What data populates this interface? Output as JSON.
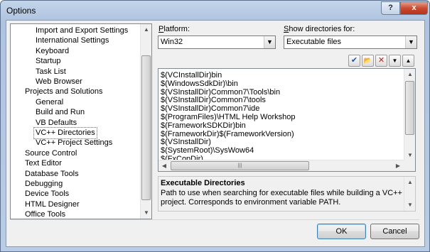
{
  "window": {
    "title": "Options",
    "help_label": "?",
    "close_label": "x"
  },
  "tree": {
    "items": [
      {
        "label": "Import and Export Settings",
        "level": 1
      },
      {
        "label": "International Settings",
        "level": 1
      },
      {
        "label": "Keyboard",
        "level": 1
      },
      {
        "label": "Startup",
        "level": 1
      },
      {
        "label": "Task List",
        "level": 1
      },
      {
        "label": "Web Browser",
        "level": 1
      },
      {
        "label": "Projects and Solutions",
        "level": 0
      },
      {
        "label": "General",
        "level": 1
      },
      {
        "label": "Build and Run",
        "level": 1
      },
      {
        "label": "VB Defaults",
        "level": 1
      },
      {
        "label": "VC++ Directories",
        "level": 1,
        "selected": true
      },
      {
        "label": "VC++ Project Settings",
        "level": 1
      },
      {
        "label": "Source Control",
        "level": 0
      },
      {
        "label": "Text Editor",
        "level": 0
      },
      {
        "label": "Database Tools",
        "level": 0
      },
      {
        "label": "Debugging",
        "level": 0
      },
      {
        "label": "Device Tools",
        "level": 0
      },
      {
        "label": "HTML Designer",
        "level": 0
      },
      {
        "label": "Office Tools",
        "level": 0
      }
    ]
  },
  "platform": {
    "label_prefix": "",
    "label_underlined": "P",
    "label_rest": "latform:",
    "value": "Win32"
  },
  "show_dirs": {
    "label_prefix": "",
    "label_underlined": "S",
    "label_rest": "how directories for:",
    "value": "Executable files"
  },
  "toolbar": {
    "check_glyph": "✔",
    "folder_glyph": "📂",
    "delete_glyph": "✕",
    "down_glyph": "▼",
    "up_glyph": "▲"
  },
  "directories": [
    "$(VCInstallDir)bin",
    "$(WindowsSdkDir)\\bin",
    "$(VSInstallDir)Common7\\Tools\\bin",
    "$(VSInstallDir)Common7\\tools",
    "$(VSInstallDir)Common7\\ide",
    "$(ProgramFiles)\\HTML Help Workshop",
    "$(FrameworkSDKDir)bin",
    "$(FrameworkDir)$(FrameworkVersion)",
    "$(VSInstallDir)",
    "$(SystemRoot)\\SysWow64",
    "$(FxCopDir)"
  ],
  "description": {
    "title": "Executable Directories",
    "body": "Path to use when searching for executable files while building a VC++ project. Corresponds to environment variable PATH."
  },
  "buttons": {
    "ok": "OK",
    "cancel": "Cancel"
  },
  "colors": {
    "delete_red": "#c0201a",
    "check_blue": "#1e4fa8"
  }
}
